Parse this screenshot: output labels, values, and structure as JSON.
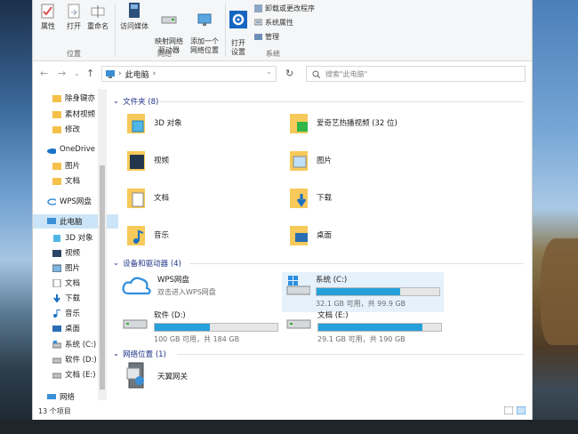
{
  "ribbon": {
    "location_group": {
      "label": "位置",
      "buttons": [
        {
          "label": "属性",
          "icon": "properties-check-icon"
        },
        {
          "label": "打开",
          "icon": "open-icon"
        },
        {
          "label": "重命名",
          "icon": "rename-icon"
        }
      ]
    },
    "network_group": {
      "label": "网络",
      "buttons": [
        {
          "label": "访问媒体",
          "icon": "media-access-icon"
        },
        {
          "label": "映射网络\n驱动器",
          "icon": "map-drive-icon"
        },
        {
          "label": "添加一个\n网络位置",
          "icon": "add-network-location-icon"
        }
      ]
    },
    "system_group": {
      "label": "系统",
      "open_settings": "打开\n设置",
      "items": [
        "卸载或更改程序",
        "系统属性",
        "管理"
      ]
    }
  },
  "address": {
    "path_item": "此电脑",
    "search_placeholder": "搜索\"此电脑\""
  },
  "nav": {
    "items": [
      {
        "label": "除身键亦",
        "icon": "folder-yellow"
      },
      {
        "label": "素材视频",
        "icon": "folder-yellow"
      },
      {
        "label": "修改",
        "icon": "folder-yellow"
      },
      {
        "label": "OneDrive",
        "icon": "cloud-icon"
      },
      {
        "label": "图片",
        "icon": "folder-yellow"
      },
      {
        "label": "文档",
        "icon": "folder-yellow"
      },
      {
        "label": "WPS网盘",
        "icon": "wps-cloud-icon"
      },
      {
        "label": "此电脑",
        "icon": "pc-icon"
      },
      {
        "label": "3D 对象",
        "icon": "3d-icon"
      },
      {
        "label": "视频",
        "icon": "video-icon"
      },
      {
        "label": "图片",
        "icon": "pictures-icon"
      },
      {
        "label": "文档",
        "icon": "docs-icon"
      },
      {
        "label": "下载",
        "icon": "download-icon"
      },
      {
        "label": "音乐",
        "icon": "music-icon"
      },
      {
        "label": "桌面",
        "icon": "desktop-icon"
      },
      {
        "label": "系统 (C:)",
        "icon": "drive-c-icon"
      },
      {
        "label": "软件 (D:)",
        "icon": "drive-icon"
      },
      {
        "label": "文档 (E:)",
        "icon": "drive-icon"
      },
      {
        "label": "网络",
        "icon": "network-icon"
      }
    ]
  },
  "content": {
    "folders_header": "文件夹 (8)",
    "folders": [
      {
        "label": "3D 对象"
      },
      {
        "label": "爱奇艺热播视频 (32 位)"
      },
      {
        "label": "视频"
      },
      {
        "label": "图片"
      },
      {
        "label": "文档"
      },
      {
        "label": "下载"
      },
      {
        "label": "音乐"
      },
      {
        "label": "桌面"
      }
    ],
    "devices_header": "设备和驱动器 (4)",
    "wps": {
      "name": "WPS网盘",
      "sub": "双击进入WPS网盘"
    },
    "drives": [
      {
        "name": "系统 (C:)",
        "detail": "32.1 GB 可用，共 99.9 GB",
        "used_fraction": 0.68
      },
      {
        "name": "软件 (D:)",
        "detail": "100 GB 可用，共 184 GB",
        "used_fraction": 0.45
      },
      {
        "name": "文档 (E:)",
        "detail": "29.1 GB 可用，共 190 GB",
        "used_fraction": 0.85
      }
    ],
    "network_header": "网络位置 (1)",
    "network_item": "天翼网关"
  },
  "status": {
    "count": "13 个项目"
  },
  "colors": {
    "accent": "#26a0da",
    "selected": "#cce4f7",
    "header_text": "#1e3287"
  }
}
